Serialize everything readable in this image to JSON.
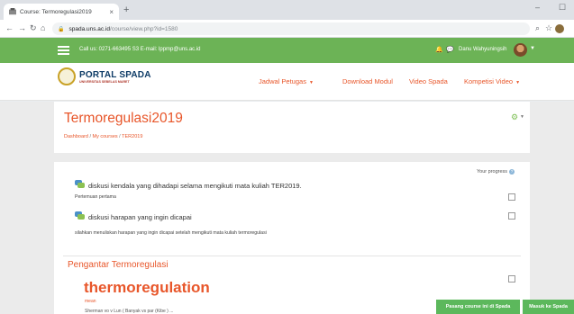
{
  "browser": {
    "tab_title": "Course: Termoregulasi2019",
    "tab_close": "×",
    "new_tab": "+",
    "url_host": "spada.uns.ac.id",
    "url_path": "/course/view.php?id=1580",
    "window_controls": {
      "minimize": "–",
      "maximize": "☐"
    },
    "nav": {
      "back": "←",
      "forward": "→",
      "reload": "↻",
      "home": "⌂"
    }
  },
  "topbar": {
    "contact": "Call us: 0271-663495  S3 E-mail: lppmp@uns.ac.id",
    "username": "Danu Wahyuningsih",
    "bg_color": "#6cb356"
  },
  "header": {
    "logo_title": "PORTAL SPADA",
    "logo_subtitle": "UNIVERSITAS SEBELAS MARET",
    "menu": [
      {
        "label": "Jadwal Petugas",
        "has_caret": true
      },
      {
        "label": "Download Modul",
        "has_caret": false
      },
      {
        "label": "Video Spada",
        "has_caret": false
      },
      {
        "label": "Kompetisi Video",
        "has_caret": true
      }
    ]
  },
  "course": {
    "title": "Termoregulasi2019",
    "breadcrumb": [
      "Dashboard",
      "My courses",
      "TER2019"
    ],
    "breadcrumb_sep": "/"
  },
  "content": {
    "progress_label": "Your progress",
    "progress_help": "?",
    "activities": [
      {
        "title": "diskusi kendala yang dihadapi selama mengikuti mata kuliah TER2019.",
        "sub": "Pertemuan pertama"
      },
      {
        "title": "diskusi harapan yang ingin dicapai",
        "sub": "silahkan menuliskan harapan yang ingin dicapai setelah mengikuti mata kuliah termoregulasi"
      }
    ],
    "section_title": "Pengantar Termoregulasi",
    "big_heading": "thermoregulation",
    "small_orange": "mean",
    "cut_text": "Sherman vo v Lun ( Banyak vs par (Kibe ) ..."
  },
  "buttons": {
    "pasang": "Pasang course ini di Spada",
    "masuk": "Masuk ke Spada"
  },
  "colors": {
    "accent": "#e8562a",
    "green": "#5cb85c"
  }
}
